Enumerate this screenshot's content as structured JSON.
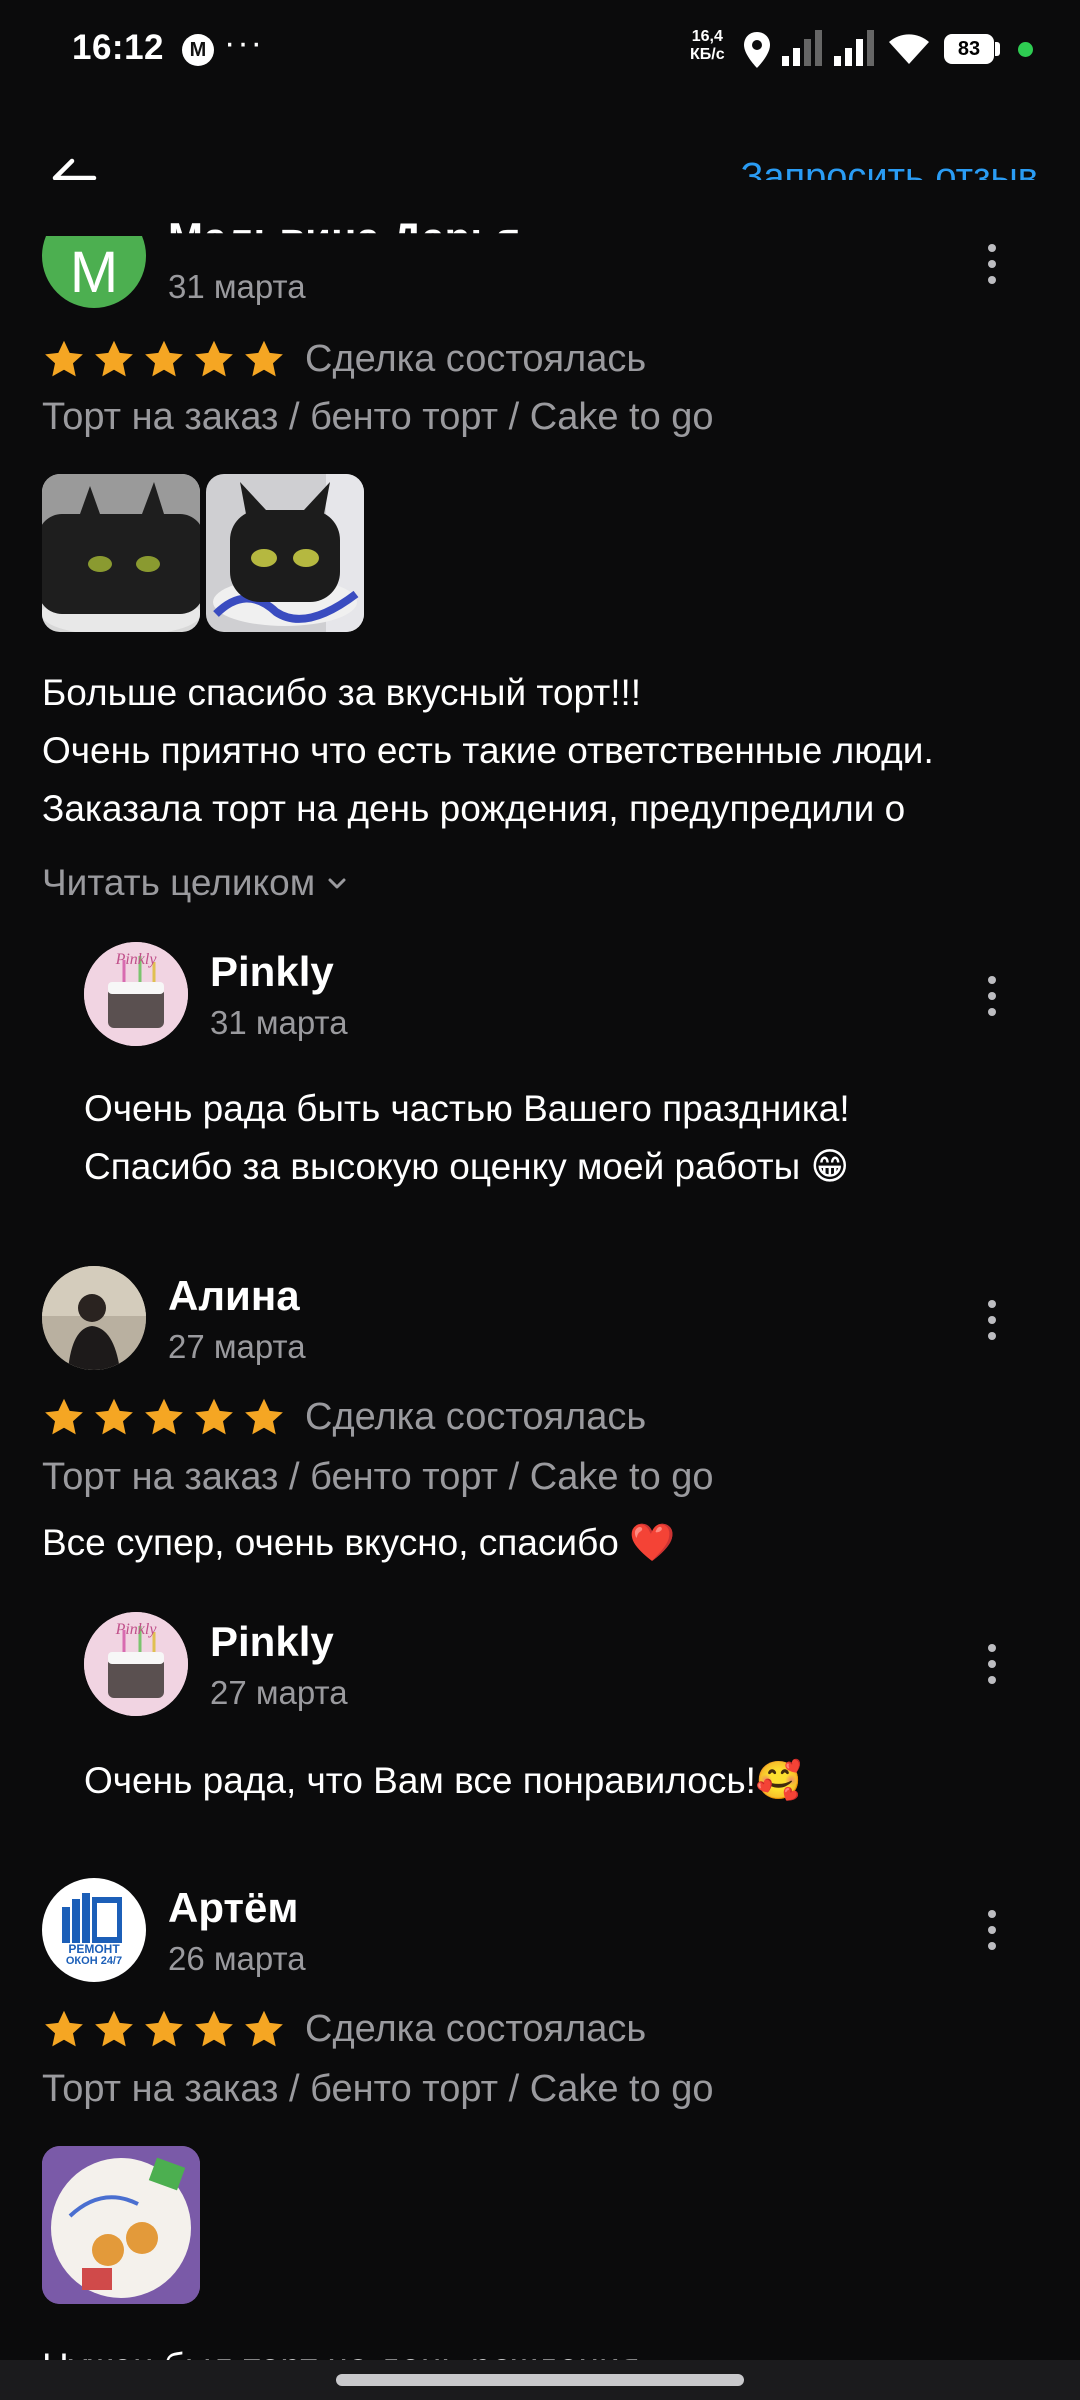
{
  "status_bar": {
    "time": "16:12",
    "carrier_badge": "M",
    "more": "···",
    "speed_value": "16,4",
    "speed_unit": "КБ/с",
    "battery": "83"
  },
  "header": {
    "request_review": "Запросить отзыв",
    "back_icon": "arrow-left-icon"
  },
  "colors": {
    "accent": "#2a9cf4",
    "star": "#f5a623",
    "muted": "#9a9a9e",
    "background": "#0b0b0c"
  },
  "reviews": [
    {
      "author": "Мальвина Дарья",
      "avatar_letter": "М",
      "date": "31 марта",
      "rating": 5,
      "status": "Сделка состоялась",
      "product": "Торт на заказ / бенто торт / Cake to go",
      "text_lines": [
        "Больше спасибо за вкусный торт!!!",
        "Очень приятно что есть такие ответственные люди.",
        "Заказала торт на день рождения,  предупредили о"
      ],
      "read_more": "Читать целиком",
      "reply": {
        "author": "Pinkly",
        "date": "31 марта",
        "text_lines": [
          "Очень рада быть частью Вашего праздника!",
          "Спасибо за высокую оценку моей работы 😁"
        ]
      }
    },
    {
      "author": "Алина",
      "date": "27 марта",
      "rating": 5,
      "status": "Сделка состоялась",
      "product": "Торт на заказ / бенто торт / Cake to go",
      "text": "Все супер, очень вкусно, спасибо ❤️",
      "reply": {
        "author": "Pinkly",
        "date": "27 марта",
        "text": "Очень рада, что Вам все понравилось!🥰"
      }
    },
    {
      "author": "Артём",
      "avatar_text_1": "РЕМОНТ",
      "avatar_text_2": "ОКОН 24/7",
      "date": "26 марта",
      "rating": 5,
      "status": "Сделка состоялась",
      "product": "Торт на заказ / бенто торт / Cake to go",
      "text_partial": "Нужен был торт на день рождения"
    }
  ]
}
